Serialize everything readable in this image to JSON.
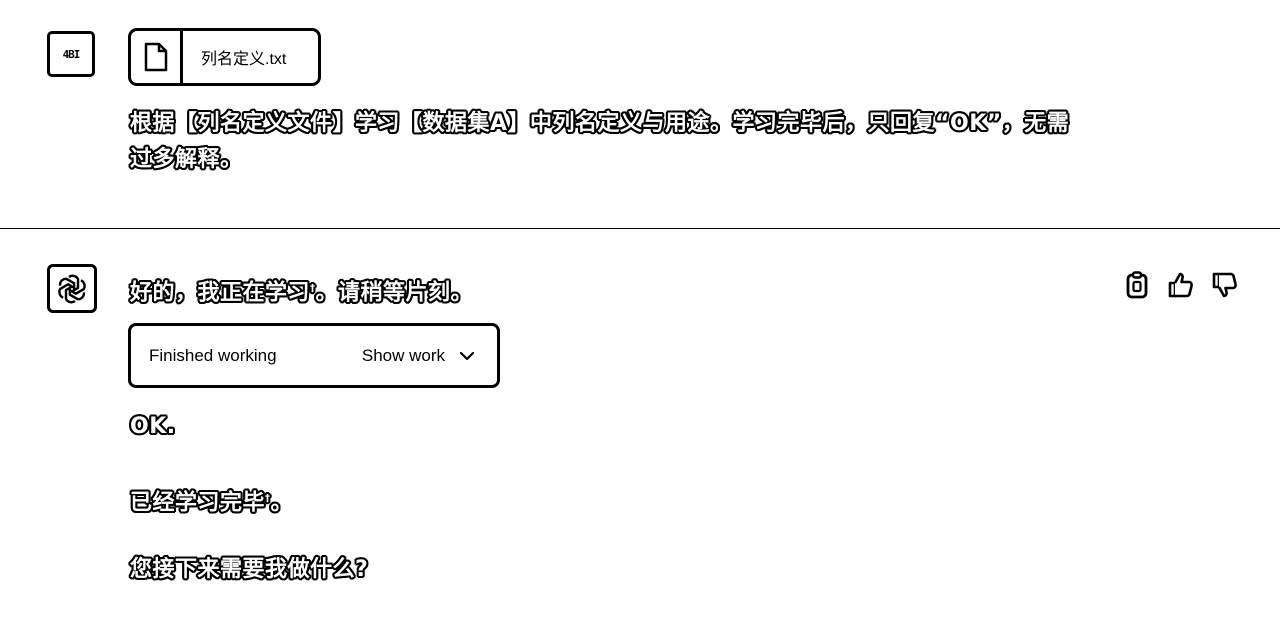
{
  "user": {
    "avatar_text": "4BI",
    "attachment": {
      "file_name": "列名定义.txt",
      "icon": "file-icon"
    },
    "message_line1": "根据【列名定义文件】学习【数据集A】中列名定义与用途。学习完毕后，只回复“OK”，无需",
    "message_line2": "过多解释。"
  },
  "assistant": {
    "avatar_icon": "openai-logo-icon",
    "intro_text": "好的，我正在学习",
    "intro_sup": "†",
    "intro_tail": "。请稍等片刻。",
    "work": {
      "status": "Finished working",
      "toggle_label": "Show work",
      "toggle_icon": "chevron-down-icon"
    },
    "reply_ok": "OK.",
    "reply_done": "已经学习完毕",
    "reply_done_sup": "†",
    "reply_done_tail": "。",
    "reply_question": "您接下来需要我做什么?",
    "actions": {
      "copy_icon": "clipboard-icon",
      "like_icon": "thumbs-up-icon",
      "dislike_icon": "thumbs-down-icon"
    }
  }
}
